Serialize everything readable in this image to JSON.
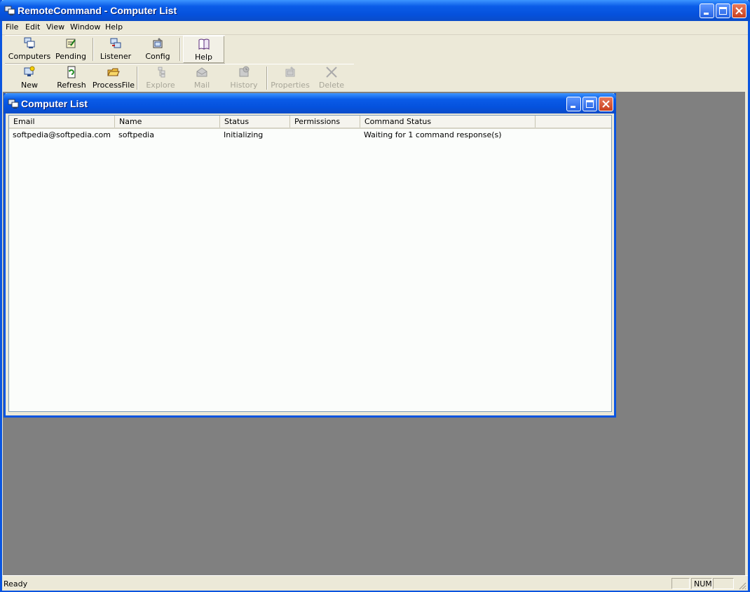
{
  "window": {
    "title": "RemoteCommand - Computer List",
    "colors": {
      "titlebar": "#0a5ce8",
      "frame": "#0a55e0",
      "close": "#c9401f",
      "workspace": "#808080"
    }
  },
  "menu": [
    "File",
    "Edit",
    "View",
    "Window",
    "Help"
  ],
  "toolbar1": [
    {
      "label": "Computers",
      "icon": "computers-icon"
    },
    {
      "label": "Pending",
      "icon": "pending-icon"
    },
    {
      "label": "Listener",
      "icon": "listener-icon"
    },
    {
      "label": "Config",
      "icon": "config-icon"
    },
    {
      "label": "Help",
      "icon": "help-book-icon",
      "pressed": true
    }
  ],
  "toolbar2": [
    {
      "label": "New",
      "icon": "new-computer-icon",
      "enabled": true
    },
    {
      "label": "Refresh",
      "icon": "refresh-icon",
      "enabled": true
    },
    {
      "label": "ProcessFile",
      "icon": "process-file-icon",
      "enabled": true
    },
    {
      "label": "Explore",
      "icon": "explore-icon",
      "enabled": false
    },
    {
      "label": "Mail",
      "icon": "mail-icon",
      "enabled": false
    },
    {
      "label": "History",
      "icon": "history-icon",
      "enabled": false
    },
    {
      "label": "Properties",
      "icon": "properties-icon",
      "enabled": false
    },
    {
      "label": "Delete",
      "icon": "delete-icon",
      "enabled": false
    }
  ],
  "child": {
    "title": "Computer List",
    "columns": [
      "Email",
      "Name",
      "Status",
      "Permissions",
      "Command Status"
    ],
    "rows": [
      [
        "softpedia@softpedia.com",
        "softpedia",
        "Initializing",
        "",
        "Waiting for 1 command response(s)"
      ]
    ]
  },
  "statusbar": {
    "text": "Ready",
    "num": "NUM"
  }
}
